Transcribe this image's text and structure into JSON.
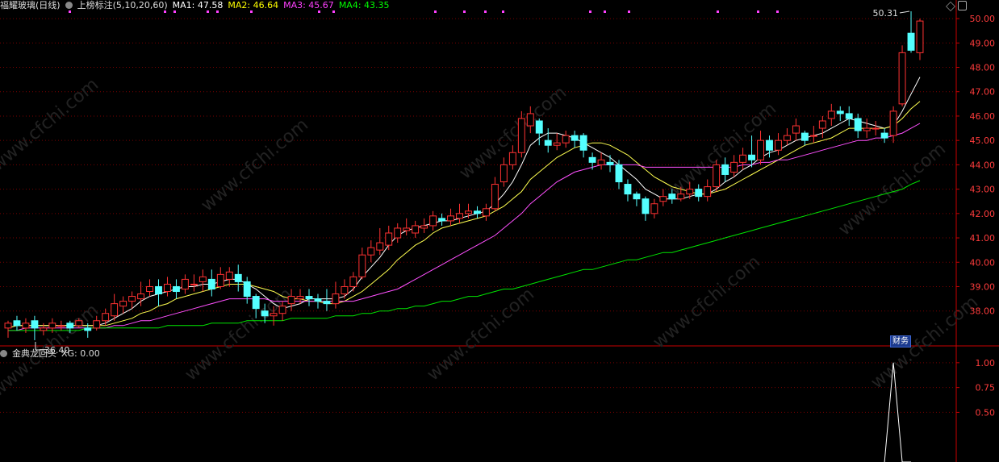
{
  "header": {
    "stock_name": "福耀玻璃(日线)",
    "indicator": "上榜标注(5,10,20,60)",
    "ma1_label": "MA1: 47.58",
    "ma2_label": "MA2: 46.64",
    "ma3_label": "MA3: 45.67",
    "ma4_label": "MA4: 43.35"
  },
  "sub_header": {
    "indicator_name": "金典龙回头",
    "xg_label": "XG: 0.00"
  },
  "badge_label": "财务",
  "colors": {
    "up": "#ff3232",
    "down": "#54ffff",
    "ma1": "#ffffff",
    "ma2": "#ffff50",
    "ma3": "#ff50ff",
    "ma4": "#00e600",
    "grid": "#7a0000",
    "axis": "#c80000",
    "ma1_text": "#ffffff",
    "ma2_text": "#ffff00",
    "ma3_text": "#ff40ff",
    "ma4_text": "#00ff00"
  },
  "chart_data": [
    {
      "type": "candlestick",
      "y_ticks": [
        50.0,
        49.0,
        48.0,
        47.0,
        46.0,
        45.0,
        44.0,
        43.0,
        42.0,
        41.0,
        40.0,
        39.0,
        38.0
      ],
      "ylim": [
        36.6,
        50.3
      ],
      "high_label": "50.31",
      "low_label": "36.40",
      "candles": [
        [
          37.3,
          37.5,
          36.9,
          37.6
        ],
        [
          37.6,
          37.4,
          37.2,
          37.8
        ],
        [
          37.3,
          37.5,
          37.1,
          37.7
        ],
        [
          37.6,
          37.3,
          36.8,
          37.8
        ],
        [
          37.2,
          37.3,
          37.0,
          37.5
        ],
        [
          37.3,
          37.5,
          37.1,
          37.7
        ],
        [
          37.4,
          37.4,
          37.2,
          37.6
        ],
        [
          37.5,
          37.3,
          37.1,
          37.6
        ],
        [
          37.4,
          37.6,
          37.3,
          37.7
        ],
        [
          37.3,
          37.2,
          36.9,
          37.5
        ],
        [
          37.3,
          37.6,
          37.2,
          37.8
        ],
        [
          37.6,
          37.9,
          37.4,
          38.1
        ],
        [
          37.8,
          38.3,
          37.6,
          38.7
        ],
        [
          38.2,
          38.4,
          37.9,
          38.6
        ],
        [
          38.4,
          38.6,
          38.1,
          38.8
        ],
        [
          38.5,
          38.7,
          38.2,
          39.2
        ],
        [
          38.8,
          39.0,
          38.6,
          39.3
        ],
        [
          39.0,
          38.7,
          38.2,
          39.3
        ],
        [
          38.8,
          39.1,
          38.6,
          39.4
        ],
        [
          39.0,
          38.8,
          38.5,
          39.3
        ],
        [
          38.9,
          39.3,
          38.7,
          39.5
        ],
        [
          39.1,
          39.1,
          38.8,
          39.5
        ],
        [
          39.2,
          39.4,
          38.8,
          39.7
        ],
        [
          39.3,
          38.9,
          38.6,
          39.7
        ],
        [
          39.0,
          39.5,
          38.9,
          39.8
        ],
        [
          39.3,
          39.6,
          39.0,
          39.8
        ],
        [
          39.5,
          39.2,
          38.8,
          39.9
        ],
        [
          39.2,
          38.6,
          38.3,
          39.4
        ],
        [
          38.6,
          38.1,
          37.7,
          38.7
        ],
        [
          38.0,
          37.8,
          37.5,
          38.3
        ],
        [
          37.8,
          37.9,
          37.4,
          38.2
        ],
        [
          37.9,
          38.2,
          37.6,
          38.4
        ],
        [
          38.3,
          38.6,
          38.0,
          38.9
        ],
        [
          38.5,
          38.6,
          38.3,
          38.9
        ],
        [
          38.6,
          38.5,
          38.2,
          38.9
        ],
        [
          38.5,
          38.4,
          38.1,
          38.7
        ],
        [
          38.4,
          38.3,
          38.0,
          38.9
        ],
        [
          38.3,
          38.7,
          38.1,
          39.2
        ],
        [
          38.7,
          39.0,
          38.5,
          39.3
        ],
        [
          39.0,
          39.4,
          38.8,
          39.6
        ],
        [
          39.4,
          40.3,
          39.3,
          40.6
        ],
        [
          40.3,
          40.6,
          40.0,
          40.9
        ],
        [
          40.5,
          40.8,
          40.3,
          41.4
        ],
        [
          40.7,
          41.2,
          40.5,
          41.5
        ],
        [
          41.0,
          41.4,
          40.8,
          41.6
        ],
        [
          41.3,
          41.4,
          41.1,
          41.8
        ],
        [
          41.2,
          41.5,
          41.0,
          41.7
        ],
        [
          41.4,
          41.5,
          41.2,
          41.8
        ],
        [
          41.5,
          41.9,
          41.3,
          42.1
        ],
        [
          41.8,
          41.7,
          41.5,
          42.0
        ],
        [
          41.7,
          41.9,
          41.5,
          42.2
        ],
        [
          41.8,
          42.0,
          41.6,
          42.4
        ],
        [
          42.0,
          42.1,
          41.8,
          42.4
        ],
        [
          42.1,
          42.0,
          41.8,
          42.3
        ],
        [
          41.9,
          42.2,
          41.7,
          42.4
        ],
        [
          42.2,
          43.2,
          42.1,
          43.5
        ],
        [
          43.3,
          44.0,
          43.1,
          44.3
        ],
        [
          44.0,
          44.5,
          43.8,
          44.8
        ],
        [
          44.5,
          45.9,
          44.3,
          46.2
        ],
        [
          45.6,
          46.1,
          45.3,
          46.4
        ],
        [
          45.8,
          45.3,
          44.8,
          45.9
        ],
        [
          45.0,
          44.8,
          44.5,
          45.5
        ],
        [
          44.8,
          44.9,
          44.6,
          45.3
        ],
        [
          44.9,
          45.2,
          44.7,
          45.4
        ],
        [
          45.2,
          45.0,
          44.7,
          45.4
        ],
        [
          45.2,
          44.6,
          44.3,
          45.3
        ],
        [
          44.3,
          44.1,
          43.8,
          44.5
        ],
        [
          44.0,
          44.2,
          43.8,
          44.5
        ],
        [
          44.1,
          44.0,
          43.7,
          44.4
        ],
        [
          44.0,
          43.3,
          43.0,
          44.2
        ],
        [
          43.2,
          42.8,
          42.5,
          43.4
        ],
        [
          42.8,
          42.6,
          42.3,
          42.9
        ],
        [
          42.6,
          42.0,
          41.7,
          42.7
        ],
        [
          42.0,
          42.4,
          41.8,
          42.6
        ],
        [
          42.5,
          42.7,
          42.3,
          43.0
        ],
        [
          42.8,
          42.6,
          42.4,
          43.0
        ],
        [
          42.6,
          42.8,
          42.5,
          43.1
        ],
        [
          42.8,
          43.0,
          42.6,
          43.3
        ],
        [
          43.0,
          42.7,
          42.5,
          43.2
        ],
        [
          42.7,
          43.1,
          42.5,
          43.4
        ],
        [
          43.1,
          44.0,
          42.9,
          44.2
        ],
        [
          44.0,
          43.6,
          43.3,
          44.3
        ],
        [
          43.7,
          44.1,
          43.5,
          44.4
        ],
        [
          44.1,
          44.4,
          43.8,
          44.7
        ],
        [
          44.4,
          44.2,
          43.9,
          45.2
        ],
        [
          44.2,
          45.0,
          44.0,
          45.4
        ],
        [
          45.0,
          44.6,
          44.3,
          45.2
        ],
        [
          44.6,
          45.0,
          44.4,
          45.3
        ],
        [
          45.0,
          45.2,
          44.8,
          45.5
        ],
        [
          45.3,
          45.6,
          45.0,
          45.9
        ],
        [
          45.3,
          45.0,
          44.8,
          45.4
        ],
        [
          45.2,
          45.2,
          44.9,
          45.6
        ],
        [
          45.5,
          45.8,
          45.1,
          46.0
        ],
        [
          45.9,
          46.2,
          45.6,
          46.5
        ],
        [
          46.2,
          46.1,
          45.8,
          46.4
        ],
        [
          46.1,
          45.9,
          45.6,
          46.4
        ],
        [
          45.9,
          45.4,
          45.1,
          46.1
        ],
        [
          45.4,
          45.5,
          45.1,
          45.9
        ],
        [
          45.5,
          45.5,
          45.2,
          45.8
        ],
        [
          45.3,
          45.1,
          44.9,
          45.5
        ],
        [
          45.2,
          46.2,
          44.9,
          46.4
        ],
        [
          46.5,
          48.6,
          46.4,
          48.9
        ],
        [
          49.4,
          48.7,
          48.6,
          50.3
        ],
        [
          48.6,
          49.9,
          48.3,
          50.0
        ]
      ],
      "ma": {
        "MA1": [
          37.3,
          37.4,
          37.4,
          37.4,
          37.4,
          37.4,
          37.4,
          37.4,
          37.4,
          37.4,
          37.4,
          37.5,
          37.7,
          37.9,
          38.1,
          38.4,
          38.6,
          38.7,
          38.8,
          38.9,
          39.0,
          39.0,
          39.1,
          39.1,
          39.2,
          39.3,
          39.3,
          39.1,
          38.9,
          38.6,
          38.3,
          38.1,
          38.2,
          38.3,
          38.5,
          38.5,
          38.5,
          38.5,
          38.6,
          38.9,
          39.4,
          39.8,
          40.2,
          40.7,
          41.1,
          41.3,
          41.4,
          41.5,
          41.6,
          41.7,
          41.7,
          41.8,
          41.9,
          42.0,
          42.1,
          42.4,
          42.8,
          43.3,
          44.0,
          44.8,
          45.1,
          45.3,
          45.3,
          45.2,
          45.1,
          44.9,
          44.7,
          44.5,
          44.3,
          44.0,
          43.7,
          43.4,
          43.0,
          42.8,
          42.6,
          42.6,
          42.6,
          42.7,
          42.8,
          42.8,
          43.0,
          43.3,
          43.5,
          43.8,
          44.0,
          44.3,
          44.5,
          44.6,
          44.8,
          45.0,
          45.1,
          45.2,
          45.3,
          45.5,
          45.7,
          45.9,
          45.8,
          45.7,
          45.6,
          45.5,
          45.6,
          46.2,
          46.9,
          47.6
        ],
        "MA2": [
          37.3,
          37.4,
          37.4,
          37.4,
          37.4,
          37.4,
          37.4,
          37.4,
          37.4,
          37.4,
          37.4,
          37.4,
          37.5,
          37.6,
          37.7,
          37.9,
          38.0,
          38.2,
          38.3,
          38.5,
          38.6,
          38.7,
          38.8,
          38.9,
          39.0,
          39.1,
          39.1,
          39.1,
          39.0,
          38.9,
          38.8,
          38.6,
          38.5,
          38.5,
          38.4,
          38.4,
          38.3,
          38.3,
          38.4,
          38.6,
          38.8,
          39.1,
          39.4,
          39.7,
          40.1,
          40.4,
          40.7,
          40.9,
          41.2,
          41.4,
          41.5,
          41.6,
          41.7,
          41.8,
          41.9,
          42.1,
          42.3,
          42.6,
          42.9,
          43.4,
          43.7,
          44.0,
          44.3,
          44.5,
          44.7,
          44.8,
          44.9,
          44.9,
          44.8,
          44.6,
          44.4,
          44.1,
          43.8,
          43.5,
          43.3,
          43.1,
          43.0,
          42.9,
          42.8,
          42.8,
          42.9,
          43.0,
          43.2,
          43.4,
          43.6,
          43.8,
          44.0,
          44.2,
          44.4,
          44.6,
          44.8,
          44.9,
          45.0,
          45.1,
          45.3,
          45.5,
          45.5,
          45.5,
          45.5,
          45.5,
          45.6,
          45.9,
          46.3,
          46.6
        ],
        "MA3": [
          37.2,
          37.2,
          37.3,
          37.3,
          37.3,
          37.3,
          37.3,
          37.3,
          37.3,
          37.3,
          37.3,
          37.3,
          37.4,
          37.4,
          37.5,
          37.6,
          37.6,
          37.7,
          37.8,
          37.9,
          38.0,
          38.1,
          38.2,
          38.3,
          38.4,
          38.5,
          38.5,
          38.5,
          38.5,
          38.5,
          38.4,
          38.4,
          38.4,
          38.4,
          38.4,
          38.4,
          38.4,
          38.4,
          38.4,
          38.4,
          38.5,
          38.6,
          38.7,
          38.8,
          38.9,
          39.1,
          39.3,
          39.5,
          39.7,
          39.9,
          40.1,
          40.3,
          40.5,
          40.7,
          40.9,
          41.1,
          41.4,
          41.7,
          42.0,
          42.4,
          42.7,
          43.0,
          43.3,
          43.5,
          43.7,
          43.8,
          43.9,
          44.0,
          44.0,
          44.0,
          44.0,
          44.0,
          43.9,
          43.9,
          43.9,
          43.9,
          43.9,
          43.9,
          43.9,
          43.9,
          43.9,
          43.9,
          43.9,
          44.0,
          44.0,
          44.1,
          44.1,
          44.2,
          44.2,
          44.3,
          44.4,
          44.5,
          44.6,
          44.7,
          44.8,
          44.9,
          45.0,
          45.0,
          45.1,
          45.1,
          45.2,
          45.3,
          45.5,
          45.7
        ],
        "MA4": [
          37.2,
          37.2,
          37.2,
          37.2,
          37.2,
          37.2,
          37.2,
          37.2,
          37.2,
          37.3,
          37.3,
          37.3,
          37.3,
          37.3,
          37.3,
          37.3,
          37.3,
          37.3,
          37.4,
          37.4,
          37.4,
          37.4,
          37.4,
          37.5,
          37.5,
          37.5,
          37.5,
          37.6,
          37.6,
          37.6,
          37.6,
          37.6,
          37.7,
          37.7,
          37.7,
          37.7,
          37.7,
          37.8,
          37.8,
          37.8,
          37.9,
          37.9,
          38.0,
          38.0,
          38.1,
          38.1,
          38.2,
          38.2,
          38.3,
          38.4,
          38.4,
          38.5,
          38.6,
          38.6,
          38.7,
          38.8,
          38.9,
          38.9,
          39.0,
          39.1,
          39.2,
          39.3,
          39.4,
          39.5,
          39.6,
          39.7,
          39.7,
          39.8,
          39.9,
          40.0,
          40.1,
          40.1,
          40.2,
          40.3,
          40.4,
          40.4,
          40.5,
          40.6,
          40.7,
          40.8,
          40.9,
          41.0,
          41.1,
          41.2,
          41.3,
          41.4,
          41.5,
          41.6,
          41.7,
          41.8,
          41.9,
          42.0,
          42.1,
          42.2,
          42.3,
          42.4,
          42.5,
          42.6,
          42.7,
          42.8,
          42.9,
          43.0,
          43.2,
          43.35
        ]
      }
    },
    {
      "type": "line",
      "name": "XG",
      "y_ticks": [
        1.0,
        0.75,
        0.5
      ],
      "ylim": [
        0,
        1.08
      ],
      "spike_index": 100,
      "values_at_spike": [
        0,
        1,
        0
      ]
    }
  ]
}
